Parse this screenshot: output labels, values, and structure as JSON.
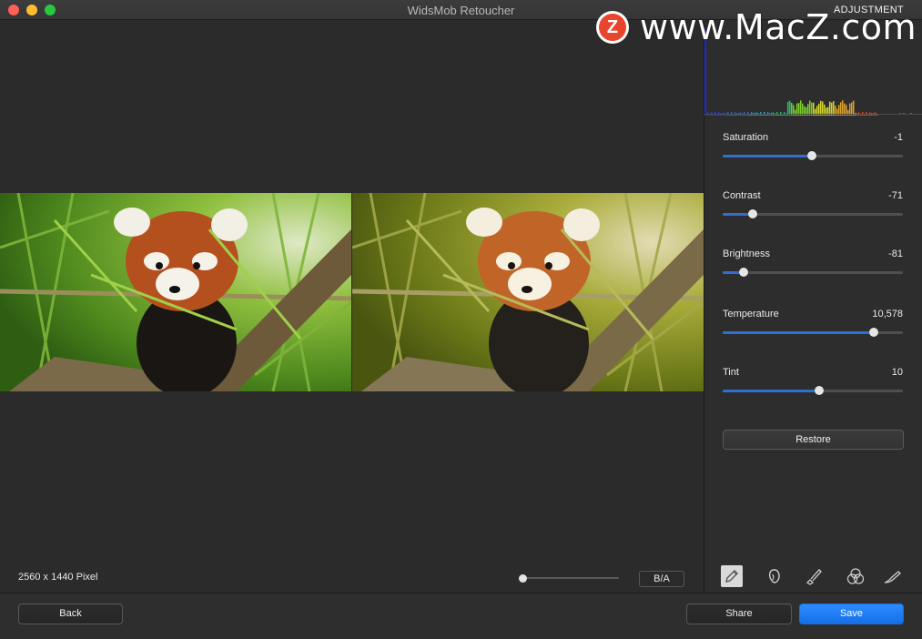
{
  "window": {
    "title": "WidsMob Retoucher",
    "panel_title": "ADJUSTMENT"
  },
  "watermark": {
    "logo_letter": "Z",
    "text": "www.MacZ.com"
  },
  "canvas": {
    "pixel_info": "2560 x 1440 Pixel",
    "ba_label": "B/A",
    "zoom_level": 0.0
  },
  "adjustments": [
    {
      "label": "Saturation",
      "value": "-1",
      "level": 0.495
    },
    {
      "label": "Contrast",
      "value": "-71",
      "level": 0.165
    },
    {
      "label": "Brightness",
      "value": "-81",
      "level": 0.115
    },
    {
      "label": "Temperature",
      "value": "10,578",
      "level": 0.84
    },
    {
      "label": "Tint",
      "value": "10",
      "level": 0.535
    }
  ],
  "restore_label": "Restore",
  "tools": [
    {
      "name": "pencil-icon",
      "active": true
    },
    {
      "name": "face-icon",
      "active": false
    },
    {
      "name": "brush-icon",
      "active": false
    },
    {
      "name": "color-circles-icon",
      "active": false
    },
    {
      "name": "pen-icon",
      "active": false
    }
  ],
  "buttons": {
    "back": "Back",
    "share": "Share",
    "save": "Save"
  },
  "colors": {
    "accent": "#2f6fd1",
    "save": "#1f7ef5",
    "background": "#2b2b2b"
  }
}
